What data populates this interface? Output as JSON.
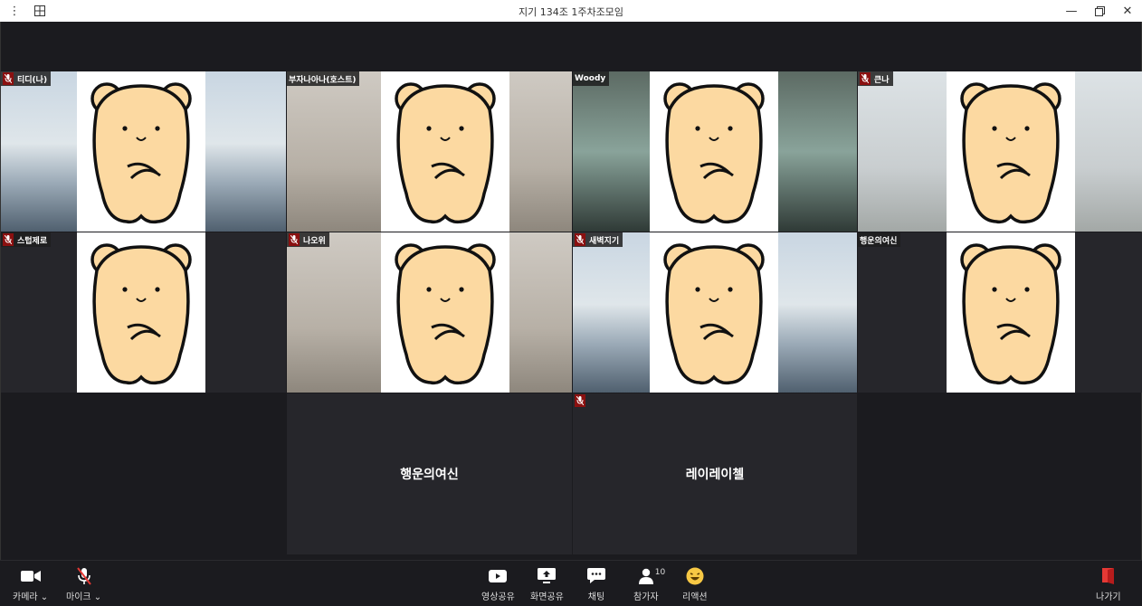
{
  "window": {
    "title": "지기 134조 1주차조모임"
  },
  "tiles": [
    {
      "name": "티디(나)",
      "muted": true
    },
    {
      "name": "부자나아나(호스트)",
      "muted": true
    },
    {
      "name": "Woody",
      "muted": false
    },
    {
      "name": "큰나",
      "muted": true
    },
    {
      "name": "스텁제로",
      "muted": true
    },
    {
      "name": "나오위",
      "muted": true
    },
    {
      "name": "새벽지기",
      "muted": true
    },
    {
      "name": "행운의여신",
      "muted": false
    }
  ],
  "audio_tiles": [
    {
      "center_name": "행운의여신"
    },
    {
      "center_name": "레이레이첼",
      "muted": true
    }
  ],
  "toolbar": {
    "camera_label": "카메라",
    "mic_label": "마이크",
    "video_share_label": "영상공유",
    "screen_share_label": "화면공유",
    "chat_label": "채팅",
    "participants_label": "참가자",
    "participants_count": "10",
    "reaction_label": "리액션",
    "leave_label": "나가기"
  },
  "colors": {
    "accent_red": "#e53935",
    "mute_red": "#8a1010",
    "reaction_yellow": "#f7c844",
    "background": "#1b1b1f"
  }
}
